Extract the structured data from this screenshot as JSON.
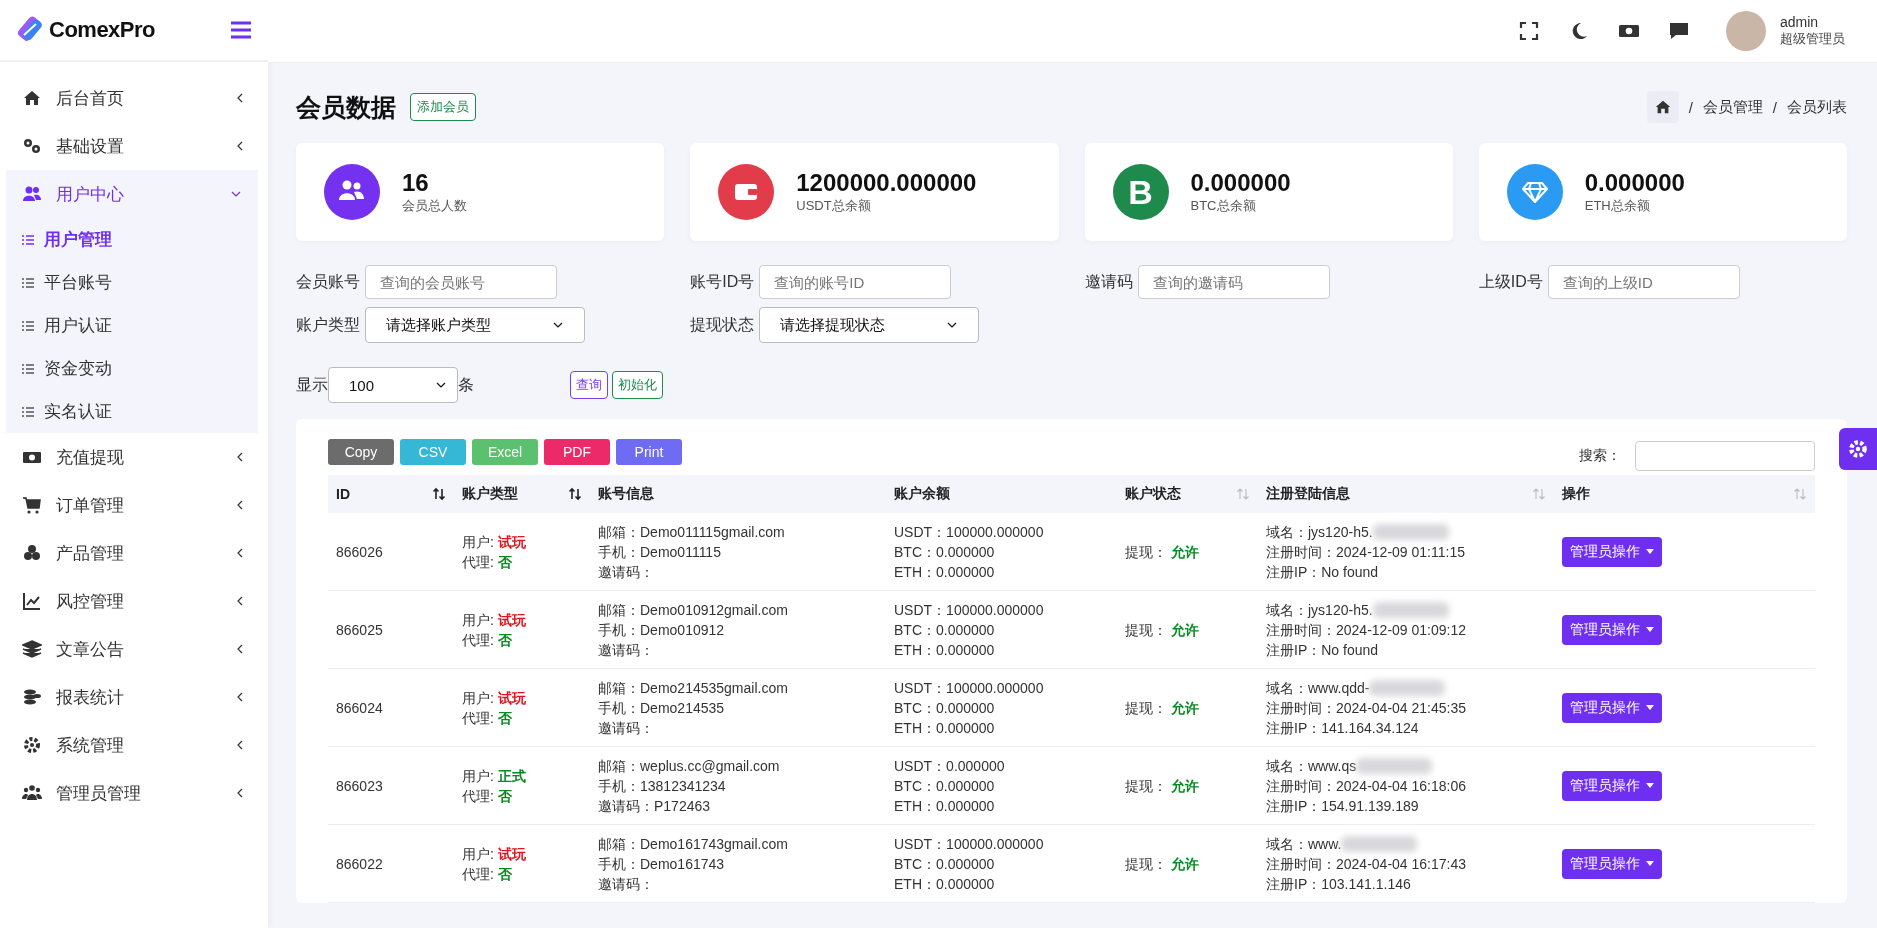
{
  "brand": {
    "name": "ComexPro"
  },
  "sidebar": {
    "items": [
      {
        "label": "后台首页",
        "expanded": false
      },
      {
        "label": "基础设置",
        "expanded": false
      },
      {
        "label": "用户中心",
        "expanded": true,
        "children": [
          {
            "label": "用户管理",
            "selected": true
          },
          {
            "label": "平台账号",
            "selected": false
          },
          {
            "label": "用户认证",
            "selected": false
          },
          {
            "label": "资金变动",
            "selected": false
          },
          {
            "label": "实名认证",
            "selected": false
          }
        ]
      },
      {
        "label": "充值提现",
        "expanded": false
      },
      {
        "label": "订单管理",
        "expanded": false
      },
      {
        "label": "产品管理",
        "expanded": false
      },
      {
        "label": "风控管理",
        "expanded": false
      },
      {
        "label": "文章公告",
        "expanded": false
      },
      {
        "label": "报表统计",
        "expanded": false
      },
      {
        "label": "系统管理",
        "expanded": false
      },
      {
        "label": "管理员管理",
        "expanded": false
      }
    ]
  },
  "header": {
    "user": {
      "name": "admin",
      "role": "超级管理员"
    }
  },
  "page": {
    "title": "会员数据",
    "add_button": "添加会员",
    "breadcrumb": [
      {
        "separator": "/",
        "label": "会员管理"
      },
      {
        "separator": "/",
        "label": "会员列表"
      }
    ]
  },
  "stats": [
    {
      "value": "16",
      "label": "会员总人数",
      "color": "#7432f0"
    },
    {
      "value": "1200000.000000",
      "label": "USDT总余额",
      "color": "#e23b4a"
    },
    {
      "value": "0.000000",
      "label": "BTC总余额",
      "color": "#1e8a4c",
      "symbol": "B"
    },
    {
      "value": "0.000000",
      "label": "ETH总余额",
      "color": "#2b9af3"
    }
  ],
  "filters": {
    "fields": [
      {
        "label": "会员账号",
        "placeholder": "查询的会员账号"
      },
      {
        "label": "账号ID号",
        "placeholder": "查询的账号ID"
      },
      {
        "label": "邀请码",
        "placeholder": "查询的邀请码"
      },
      {
        "label": "上级ID号",
        "placeholder": "查询的上级ID"
      }
    ],
    "selects": [
      {
        "label": "账户类型",
        "value": "请选择账户类型"
      },
      {
        "label": "提现状态",
        "value": "请选择提现状态"
      }
    ],
    "page_size": {
      "label": "显示",
      "value": "100",
      "unit": "条"
    },
    "buttons": [
      "查询",
      "初始化"
    ]
  },
  "table": {
    "export_buttons": [
      {
        "label": "Copy",
        "color": "#6c6c6c"
      },
      {
        "label": "CSV",
        "color": "#35b8d6"
      },
      {
        "label": "Excel",
        "color": "#5cc16e"
      },
      {
        "label": "PDF",
        "color": "#ec2a6a"
      },
      {
        "label": "Print",
        "color": "#6f6cf3"
      }
    ],
    "search_label": "搜索：",
    "columns": [
      {
        "label": "ID",
        "sortable": true,
        "sorted": true
      },
      {
        "label": "账户类型",
        "sortable": true,
        "sorted": true
      },
      {
        "label": "账号信息",
        "sortable": false
      },
      {
        "label": "账户余额",
        "sortable": false
      },
      {
        "label": "账户状态",
        "sortable": true,
        "sorted": false
      },
      {
        "label": "注册登陆信息",
        "sortable": true,
        "sorted": false
      },
      {
        "label": "操作",
        "sortable": true,
        "sorted": false
      }
    ],
    "rows": [
      {
        "id": "866026",
        "user_label": "用户:",
        "user_type": "试玩",
        "trial": true,
        "agent_label": "代理:",
        "agent": "否",
        "account": [
          "邮箱：Demo011115gmail.com",
          "手机：Demo011115",
          "邀请码："
        ],
        "balance": [
          "USDT：100000.000000",
          "BTC：0.000000",
          "ETH：0.000000"
        ],
        "withdraw_label": "提现：",
        "withdraw": "允许",
        "domain": "域名：jys120-h5.",
        "redacted": true,
        "reg_time": "注册时间：2024-12-09 01:11:15",
        "reg_ip": "注册IP：No found",
        "action": "管理员操作"
      },
      {
        "id": "866025",
        "user_label": "用户:",
        "user_type": "试玩",
        "trial": true,
        "agent_label": "代理:",
        "agent": "否",
        "account": [
          "邮箱：Demo010912gmail.com",
          "手机：Demo010912",
          "邀请码："
        ],
        "balance": [
          "USDT：100000.000000",
          "BTC：0.000000",
          "ETH：0.000000"
        ],
        "withdraw_label": "提现：",
        "withdraw": "允许",
        "domain": "域名：jys120-h5.",
        "redacted": true,
        "reg_time": "注册时间：2024-12-09 01:09:12",
        "reg_ip": "注册IP：No found",
        "action": "管理员操作"
      },
      {
        "id": "866024",
        "user_label": "用户:",
        "user_type": "试玩",
        "trial": true,
        "agent_label": "代理:",
        "agent": "否",
        "account": [
          "邮箱：Demo214535gmail.com",
          "手机：Demo214535",
          "邀请码："
        ],
        "balance": [
          "USDT：100000.000000",
          "BTC：0.000000",
          "ETH：0.000000"
        ],
        "withdraw_label": "提现：",
        "withdraw": "允许",
        "domain": "域名：www.qdd-",
        "redacted": true,
        "reg_time": "注册时间：2024-04-04 21:45:35",
        "reg_ip": "注册IP：141.164.34.124",
        "action": "管理员操作"
      },
      {
        "id": "866023",
        "user_label": "用户:",
        "user_type": "正式",
        "trial": false,
        "agent_label": "代理:",
        "agent": "否",
        "account": [
          "邮箱：weplus.cc@gmail.com",
          "手机：13812341234",
          "邀请码：P172463"
        ],
        "balance": [
          "USDT：0.000000",
          "BTC：0.000000",
          "ETH：0.000000"
        ],
        "withdraw_label": "提现：",
        "withdraw": "允许",
        "domain": "域名：www.qs",
        "redacted": true,
        "reg_time": "注册时间：2024-04-04 16:18:06",
        "reg_ip": "注册IP：154.91.139.189",
        "action": "管理员操作"
      },
      {
        "id": "866022",
        "user_label": "用户:",
        "user_type": "试玩",
        "trial": true,
        "agent_label": "代理:",
        "agent": "否",
        "account": [
          "邮箱：Demo161743gmail.com",
          "手机：Demo161743",
          "邀请码："
        ],
        "balance": [
          "USDT：100000.000000",
          "BTC：0.000000",
          "ETH：0.000000"
        ],
        "withdraw_label": "提现：",
        "withdraw": "允许",
        "domain": "域名：www.",
        "redacted": true,
        "reg_time": "注册时间：2024-04-04 16:17:43",
        "reg_ip": "注册IP：103.141.1.146",
        "action": "管理员操作"
      }
    ]
  }
}
